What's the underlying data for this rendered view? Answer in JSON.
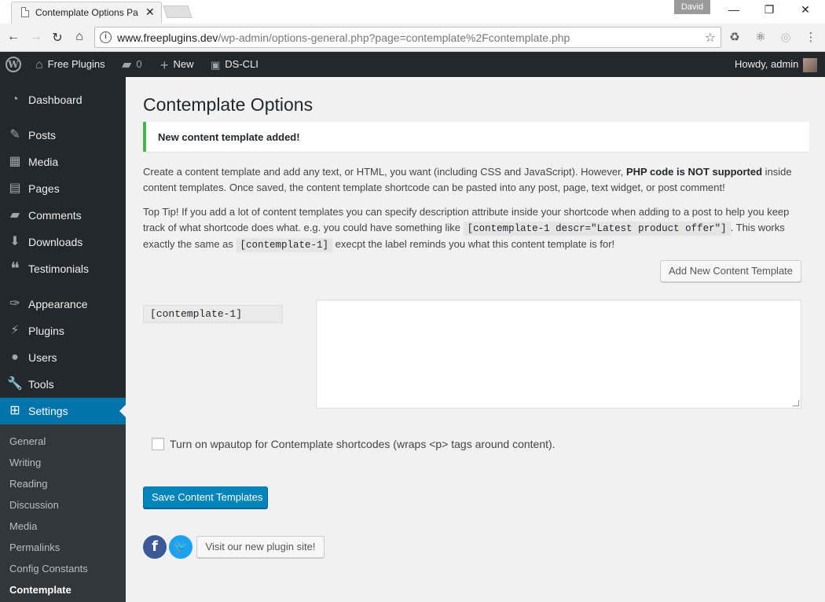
{
  "browser": {
    "tab_title": "Contemplate Options Pa",
    "profile_name": "David",
    "url_host": "www.freeplugins.dev",
    "url_path": "/wp-admin/options-general.php?page=contemplate%2Fcontemplate.php"
  },
  "adminbar": {
    "site_name": "Free Plugins",
    "comments_count": "0",
    "new_label": "New",
    "cli_label": "DS-CLI",
    "howdy": "Howdy, admin"
  },
  "sidebar": {
    "items": [
      {
        "label": "Dashboard",
        "icon": "dashboard-icon"
      },
      {
        "label": "Posts",
        "icon": "pin-icon"
      },
      {
        "label": "Media",
        "icon": "media-icon"
      },
      {
        "label": "Pages",
        "icon": "pages-icon"
      },
      {
        "label": "Comments",
        "icon": "comment-icon"
      },
      {
        "label": "Downloads",
        "icon": "download-icon"
      },
      {
        "label": "Testimonials",
        "icon": "quote-icon"
      },
      {
        "label": "Appearance",
        "icon": "brush-icon"
      },
      {
        "label": "Plugins",
        "icon": "plug-icon"
      },
      {
        "label": "Users",
        "icon": "user-icon"
      },
      {
        "label": "Tools",
        "icon": "wrench-icon"
      },
      {
        "label": "Settings",
        "icon": "settings-icon"
      }
    ],
    "submenu": [
      "General",
      "Writing",
      "Reading",
      "Discussion",
      "Media",
      "Permalinks",
      "Config Constants",
      "Contemplate"
    ]
  },
  "main": {
    "title": "Contemplate Options",
    "notice": "New content template added!",
    "para1_a": "Create a content template and add any text, or HTML, you want (including CSS and JavaScript). However, ",
    "para1_bold": "PHP code is NOT supported",
    "para1_b": " inside content templates. Once saved, the content template shortcode can be pasted into any post, page, text widget, or post comment!",
    "para2_a": "Top Tip! If you add a lot of content templates you can specify description attribute inside your shortcode when adding to a post to help you keep track of what shortcode does what. e.g. you could have something like ",
    "para2_code1": "[contemplate-1 descr=\"Latest product offer\"]",
    "para2_b": ". This works exactly the same as ",
    "para2_code2": "[contemplate-1]",
    "para2_c": " execpt the label reminds you what this content template is for!",
    "add_button": "Add New Content Template",
    "shortcode": "[contemplate-1]",
    "template_content": "",
    "wpautop_label": "Turn on wpautop for Contemplate shortcodes (wraps <p> tags around content).",
    "wpautop_checked": false,
    "save_button": "Save Content Templates",
    "visit_button": "Visit our new plugin site!"
  }
}
